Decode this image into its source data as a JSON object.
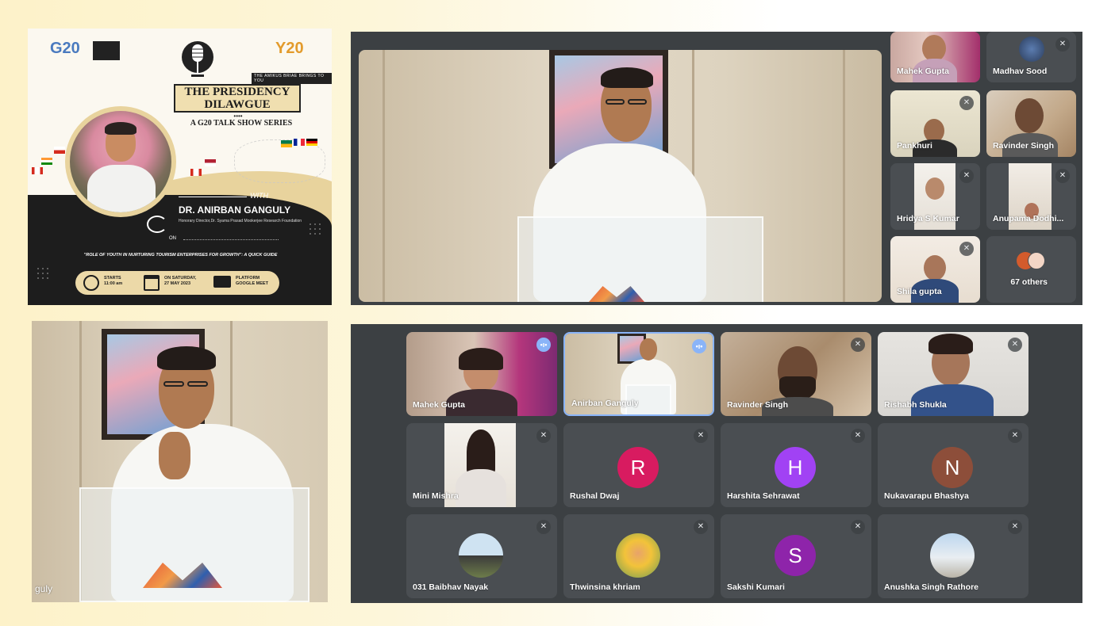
{
  "poster": {
    "logo_left": "G20",
    "logo_right": "Y20",
    "brings_you": "THE AMIKUS BRIAE BRINGS TO YOU",
    "title_line1": "THE PRESIDENCY",
    "title_line2": "DILAWGUE",
    "subtitle": "A G20 TALK SHOW SERIES",
    "with_label": "WITH",
    "speaker_name": "DR. ANIRBAN GANGULY",
    "speaker_affiliation": "Honorary Director,Dr. Syama Prasad Mookerjee Research Foundation",
    "on_label": "ON",
    "topic": "\"ROLE OF YOUTH IN NURTURING TOURISM ENTERPRISES FOR GROWTH\": A QUICK GUIDE",
    "starts_label": "STARTS",
    "starts_time": "11:00 am",
    "date_label": "ON SATURDAY,",
    "date_value": "27 MAY 2023",
    "platform_label": "PLATFORM",
    "platform_value": "GOOGLE MEET"
  },
  "top_meet": {
    "side_tiles": [
      {
        "name": "Mahek Gupta",
        "type": "video",
        "muted": false
      },
      {
        "name": "Madhav Sood",
        "type": "photo",
        "muted": true
      },
      {
        "name": "Pankhuri",
        "type": "video",
        "muted": true
      },
      {
        "name": "Ravinder Singh",
        "type": "video",
        "muted": false
      },
      {
        "name": "Hridya S Kumar",
        "type": "video",
        "muted": true
      },
      {
        "name": "Anupama Dodhi...",
        "type": "video",
        "muted": true
      },
      {
        "name": "Shila gupta",
        "type": "video",
        "muted": true
      },
      {
        "name": "67 others",
        "type": "others",
        "muted": false
      }
    ]
  },
  "bottom_left": {
    "caption": "guly"
  },
  "bottom_meet": {
    "tiles": [
      {
        "name": "Mahek Gupta",
        "type": "video",
        "status": "speaking"
      },
      {
        "name": "Anirban Ganguly",
        "type": "video",
        "status": "speaking"
      },
      {
        "name": "Ravinder Singh",
        "type": "video",
        "status": "muted"
      },
      {
        "name": "Rishabh Shukla",
        "type": "video",
        "status": "muted"
      },
      {
        "name": "Mini Mishra",
        "type": "video",
        "status": "muted"
      },
      {
        "name": "Rushal Dwaj",
        "type": "letter",
        "letter": "R",
        "color": "#d81b60",
        "status": "muted"
      },
      {
        "name": "Harshita Sehrawat",
        "type": "letter",
        "letter": "H",
        "color": "#a142f4",
        "status": "muted"
      },
      {
        "name": "Nukavarapu Bhashya",
        "type": "letter",
        "letter": "N",
        "color": "#8d4e3a",
        "status": "muted"
      },
      {
        "name": "031 Baibhav Nayak",
        "type": "photo",
        "status": "muted"
      },
      {
        "name": "Thwinsina khriam",
        "type": "photo",
        "status": "muted"
      },
      {
        "name": "Sakshi Kumari",
        "type": "letter",
        "letter": "S",
        "color": "#8e24aa",
        "status": "muted"
      },
      {
        "name": "Anushka Singh Rathore",
        "type": "photo",
        "status": "muted"
      }
    ]
  },
  "icons": {
    "mute": "mic-off-icon",
    "speaking": "audio-level-icon"
  }
}
